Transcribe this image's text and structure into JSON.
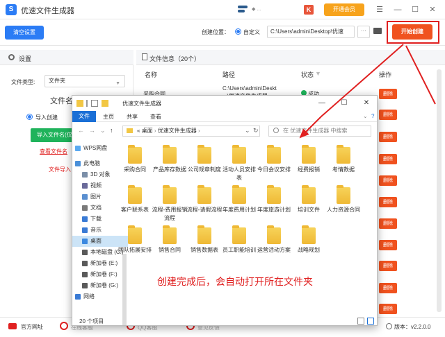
{
  "app": {
    "title": "优速文件生成器",
    "logo_letter": "S",
    "user_name": "◆ ...",
    "vip_label": "开通会员",
    "k_label": "K",
    "menu_icon": "menu-icon",
    "min_icon": "minimize-icon",
    "max_icon": "maximize-icon",
    "close_icon": "close-icon"
  },
  "toolbar": {
    "clear_label": "清空设置",
    "location_label": "创建位置：",
    "custom_label": "自定义",
    "path_value": "C:\\Users\\admin\\Desktop\\优速",
    "more_label": "···",
    "start_label": "开始创建"
  },
  "settings": {
    "title": "设置",
    "filetype_label": "文件类型:",
    "filetype_value": "文件夹",
    "filename_title": "文件名",
    "import_create_label": "导入创建",
    "import_btn_label": "导入文件名(仅",
    "view_link": "查看文件名",
    "import_tip": "文件导入"
  },
  "list": {
    "title": "文件信息（20个）",
    "col_name": "名称",
    "col_path": "路径",
    "col_status": "状态",
    "col_action": "操作",
    "first_row": {
      "name": "采购合同",
      "path_line1": "C:\\Users\\admin\\Deskt",
      "path_line2": "...\\优速文件生成器",
      "status": "成功"
    },
    "delete_label": "删除",
    "delete_count": 9
  },
  "bottom": {
    "site_label": "官方网址",
    "partial1": "在线客服",
    "partial2": "QQ客服",
    "partial3": "意见反馈",
    "version_label": "版本：",
    "version_value": "v2.2.0.0"
  },
  "explorer": {
    "title": "优速文件生成器",
    "ribbon": [
      "文件",
      "主页",
      "共享",
      "查看"
    ],
    "address_prefix": "«",
    "address_path": [
      "桌面",
      "优速文件生成器"
    ],
    "search_placeholder": "在 优速文件生成器 中搜索",
    "nav": [
      "WPS网盘",
      "此电脑",
      "3D 对象",
      "视频",
      "图片",
      "文档",
      "下载",
      "音乐",
      "桌面",
      "本地磁盘 (C:)",
      "新加卷 (E:)",
      "新加卷 (F:)",
      "新加卷 (G:)",
      "网络"
    ],
    "folders": [
      "采购合同",
      "产品库存数据",
      "公司规章制度",
      "活动人员安排表",
      "今日会议安排",
      "经费报销",
      "考情数据",
      "客户联系表",
      "流程-费用报销流程",
      "流程-请假流程",
      "年度费用计划",
      "年度旅游计划",
      "培训文件",
      "人力资源合同",
      "团队拓展安排",
      "销售合同",
      "销售数据表",
      "员工职能培训",
      "运营活动方案",
      "战略规划"
    ],
    "annotation": "创建完成后，会自动打开所在文件夹",
    "status": "20 个项目"
  }
}
